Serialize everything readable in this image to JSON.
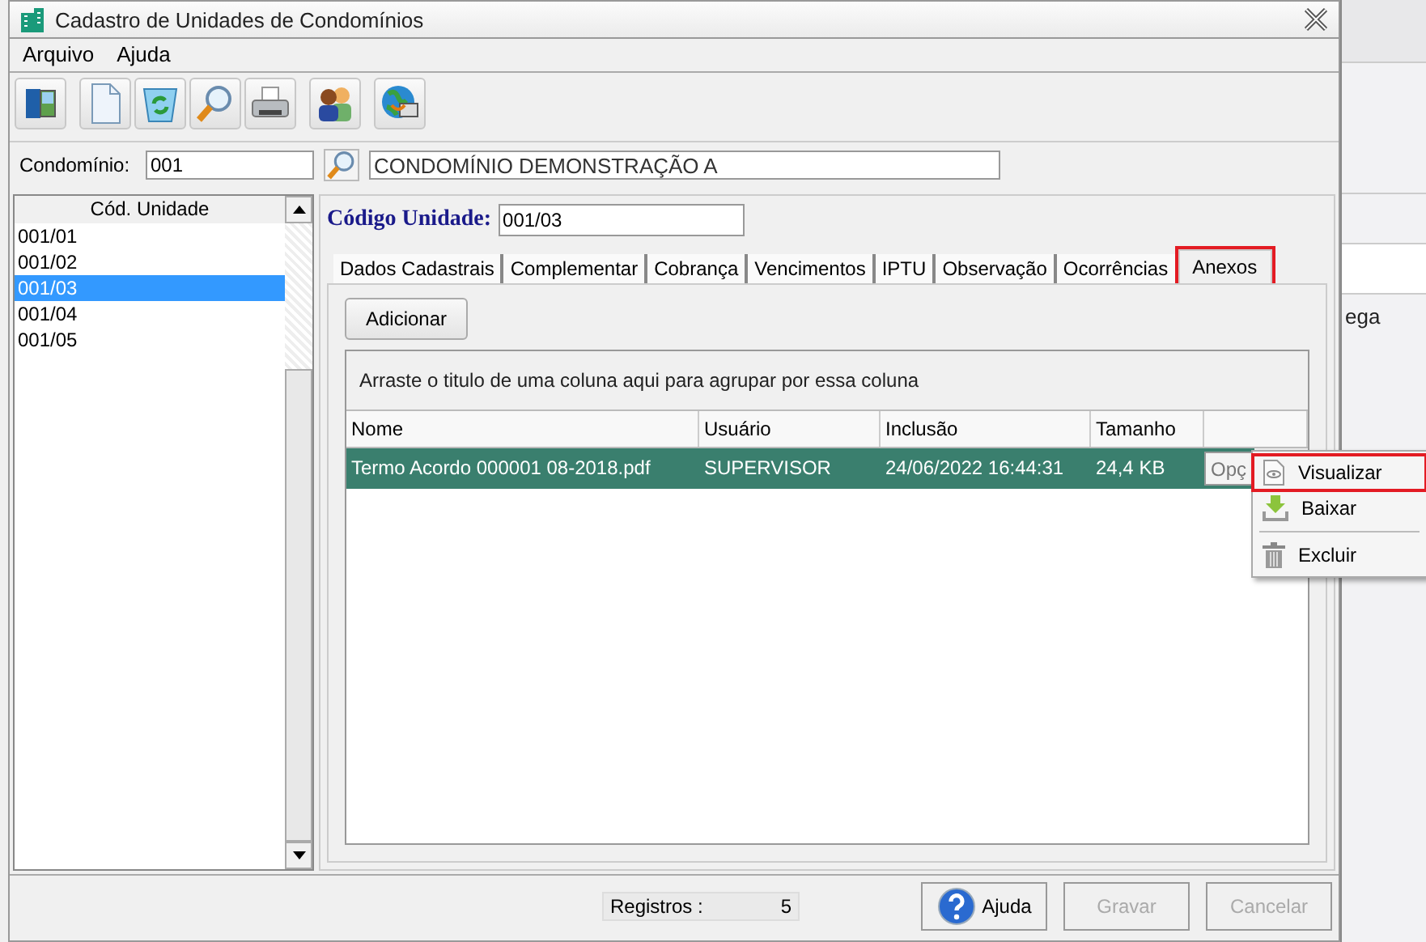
{
  "window": {
    "title": "Cadastro de Unidades de Condomínios"
  },
  "menu": [
    "Arquivo",
    "Ajuda"
  ],
  "toolbar": [
    {
      "kind": "exit"
    },
    {
      "kind": "new"
    },
    {
      "kind": "refresh"
    },
    {
      "kind": "search"
    },
    {
      "kind": "print"
    },
    {
      "kind": "people"
    },
    {
      "kind": "globe"
    }
  ],
  "condominio": {
    "label": "Condomínio:",
    "code": "001",
    "name": "CONDOMÍNIO DEMONSTRAÇÃO A"
  },
  "units": {
    "column": "Cód. Unidade",
    "items": [
      {
        "code": "001/01",
        "selected": false
      },
      {
        "code": "001/02",
        "selected": false
      },
      {
        "code": "001/03",
        "selected": true
      },
      {
        "code": "001/04",
        "selected": false
      },
      {
        "code": "001/05",
        "selected": false
      }
    ]
  },
  "unit_code": {
    "label": "Código Unidade:",
    "value": "001/03"
  },
  "tabs": [
    {
      "label": "Dados Cadastrais",
      "selected": false,
      "highlighted": false
    },
    {
      "label": "Complementar",
      "selected": false,
      "highlighted": false
    },
    {
      "label": "Cobrança",
      "selected": false,
      "highlighted": false
    },
    {
      "label": "Vencimentos",
      "selected": false,
      "highlighted": false
    },
    {
      "label": "IPTU",
      "selected": false,
      "highlighted": false
    },
    {
      "label": "Observação",
      "selected": false,
      "highlighted": false
    },
    {
      "label": "Ocorrências",
      "selected": false,
      "highlighted": false
    },
    {
      "label": "Anexos",
      "selected": true,
      "highlighted": true
    }
  ],
  "add_button": "Adicionar",
  "group_hint": "Arraste o titulo de uma coluna aqui para agrupar por essa coluna",
  "table": {
    "columns": [
      "Nome",
      "Usuário",
      "Inclusão",
      "Tamanho"
    ],
    "rows": [
      {
        "cells": [
          "Termo Acordo 000001 08-2018.pdf",
          "SUPERVISOR",
          "24/06/2022 16:44:31",
          "24,4 KB"
        ],
        "action": "Opç",
        "selected": true
      }
    ]
  },
  "context_menu": {
    "items": [
      {
        "kind": "view",
        "label": "Visualizar",
        "highlighted": true
      },
      {
        "kind": "download",
        "label": "Baixar",
        "highlighted": false
      },
      {
        "kind": "separator"
      },
      {
        "kind": "delete",
        "label": "Excluir",
        "highlighted": false
      }
    ]
  },
  "status": {
    "label": "Registros :",
    "count": "5"
  },
  "buttons": [
    {
      "kind": "help",
      "label": "Ajuda",
      "disabled": false
    },
    {
      "kind": "plain",
      "label": "Gravar",
      "disabled": true
    },
    {
      "kind": "plain",
      "label": "Cancelar",
      "disabled": true
    }
  ],
  "background_window": {
    "text": "ega"
  }
}
